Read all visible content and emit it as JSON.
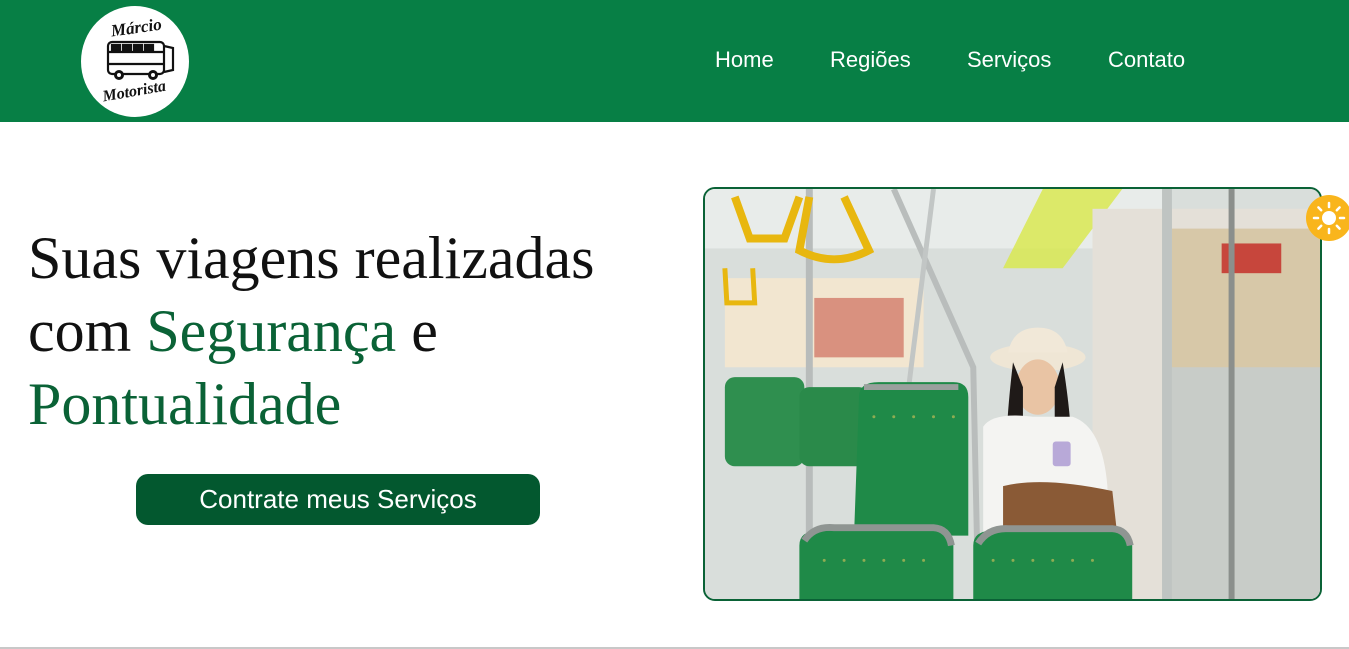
{
  "header": {
    "logo": {
      "line1": "Márcio",
      "line2": "Motorista",
      "icon": "bus-icon"
    },
    "nav": [
      {
        "label": "Home"
      },
      {
        "label": "Regiões"
      },
      {
        "label": "Serviços"
      },
      {
        "label": "Contato"
      }
    ],
    "background_color": "#077f45"
  },
  "hero": {
    "title_line1": "Suas viagens realizadas",
    "title_word_com": "com",
    "title_highlight1": "Segurança",
    "title_word_e": "e",
    "title_highlight2": "Pontualidade",
    "highlight_color": "#0a6236",
    "cta_label": "Contrate meus Serviços",
    "cta_color": "#03582f",
    "image": "photo of woman sitting on a bus using a phone"
  },
  "theme_toggle": {
    "icon": "sun-icon",
    "color": "#f9b51c"
  }
}
